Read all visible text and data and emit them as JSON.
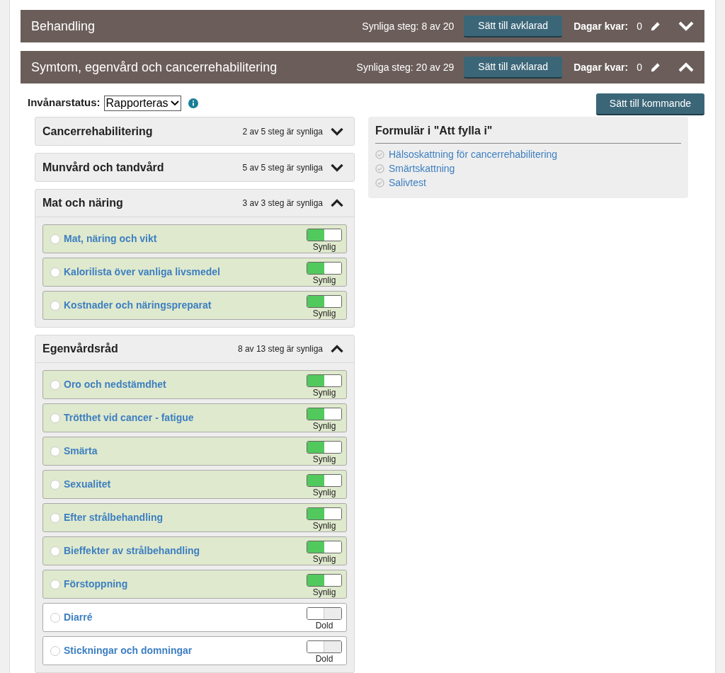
{
  "sections": [
    {
      "title": "Behandling",
      "visible_steps": "Synliga steg: 8 av 20",
      "button": "Sätt till avklarad",
      "days_label": "Dagar kvar:",
      "days": "0",
      "expanded": false
    },
    {
      "title": "Symtom, egenvård och cancerrehabilitering",
      "visible_steps": "Synliga steg: 20 av 29",
      "button": "Sätt till avklarad",
      "days_label": "Dagar kvar:",
      "days": "0",
      "expanded": true
    }
  ],
  "status": {
    "label": "Invånarstatus:",
    "value": "Rapporteras",
    "button": "Sätt till kommande"
  },
  "groups": [
    {
      "title": "Cancerrehabilitering",
      "count": "2 av 5 steg är synliga",
      "expanded": false
    },
    {
      "title": "Munvård och tandvård",
      "count": "5 av 5 steg är synliga",
      "expanded": false
    },
    {
      "title": "Mat och näring",
      "count": "3 av 3 steg är synliga",
      "expanded": true,
      "steps": [
        {
          "label": "Mat, näring och vikt",
          "checked": false,
          "visible": true,
          "toggle_label": "Synlig"
        },
        {
          "label": "Kalorilista över vanliga livsmedel",
          "checked": false,
          "visible": true,
          "toggle_label": "Synlig"
        },
        {
          "label": "Kostnader och näringspreparat",
          "checked": false,
          "visible": true,
          "toggle_label": "Synlig"
        }
      ]
    },
    {
      "title": "Egenvårdsråd",
      "count": "8 av 13 steg är synliga",
      "expanded": true,
      "steps": [
        {
          "label": "Oro och nedstämdhet",
          "checked": false,
          "visible": true,
          "toggle_label": "Synlig"
        },
        {
          "label": "Trötthet vid cancer - fatigue",
          "checked": false,
          "visible": true,
          "toggle_label": "Synlig"
        },
        {
          "label": "Smärta",
          "checked": false,
          "visible": true,
          "toggle_label": "Synlig"
        },
        {
          "label": "Sexualitet",
          "checked": false,
          "visible": true,
          "toggle_label": "Synlig"
        },
        {
          "label": "Efter strålbehandling",
          "checked": false,
          "visible": true,
          "toggle_label": "Synlig"
        },
        {
          "label": "Bieffekter av strålbehandling",
          "checked": false,
          "visible": true,
          "toggle_label": "Synlig"
        },
        {
          "label": "Förstoppning",
          "checked": false,
          "visible": true,
          "toggle_label": "Synlig"
        },
        {
          "label": "Diarré",
          "checked": false,
          "visible": false,
          "toggle_label": "Dold"
        },
        {
          "label": "Stickningar och domningar",
          "checked": false,
          "visible": false,
          "toggle_label": "Dold"
        }
      ]
    }
  ],
  "forms": {
    "title": "Formulär i \"Att fylla i\"",
    "items": [
      "Hälsoskattning för cancerrehabilitering",
      "Smärtskattning",
      "Salivtest"
    ]
  }
}
